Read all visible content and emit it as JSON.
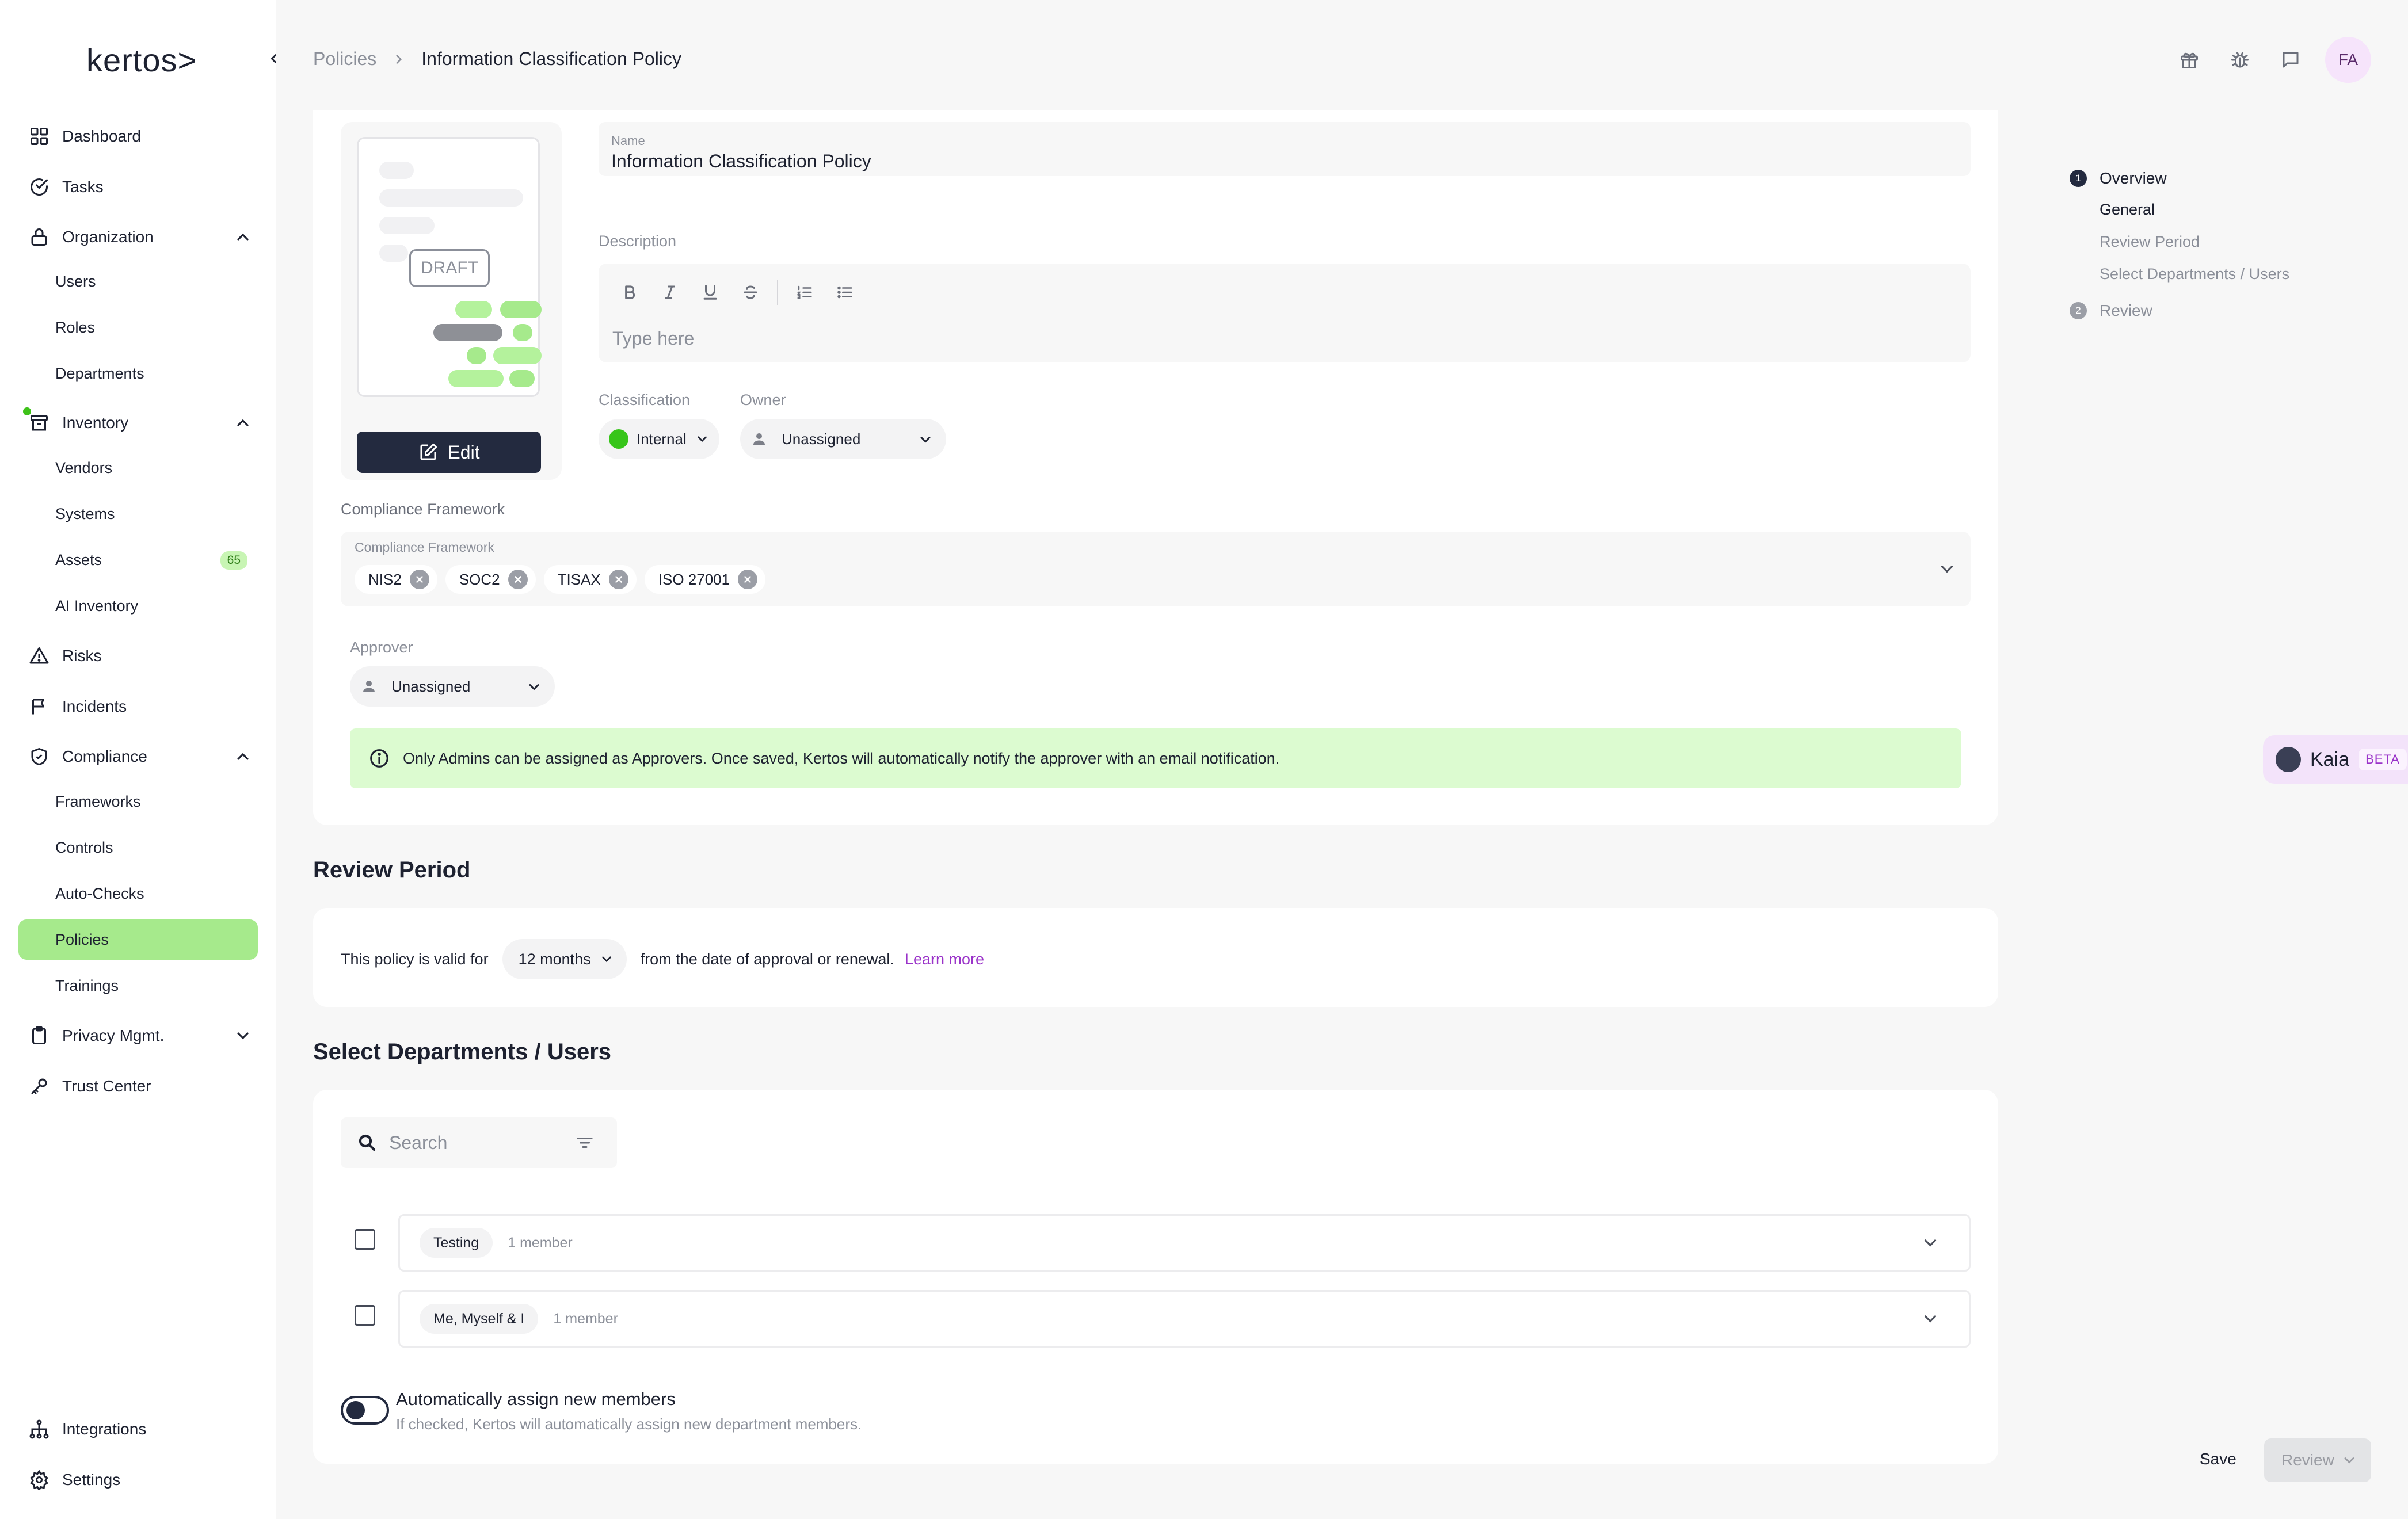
{
  "app": {
    "logo": "kertos>",
    "colors": {
      "accent_green": "#a6ea8c",
      "dark": "#232a3f",
      "purple": "#9a33c9"
    }
  },
  "sidebar": {
    "dashboard": "Dashboard",
    "tasks": "Tasks",
    "organization": "Organization",
    "users": "Users",
    "roles": "Roles",
    "departments": "Departments",
    "inventory": "Inventory",
    "vendors": "Vendors",
    "systems": "Systems",
    "assets": "Assets",
    "assets_count": "65",
    "ai_inventory": "AI Inventory",
    "risks": "Risks",
    "incidents": "Incidents",
    "compliance": "Compliance",
    "frameworks": "Frameworks",
    "controls": "Controls",
    "auto_checks": "Auto-Checks",
    "policies": "Policies",
    "trainings": "Trainings",
    "privacy": "Privacy Mgmt.",
    "trust_center": "Trust Center",
    "integrations": "Integrations",
    "settings": "Settings"
  },
  "header": {
    "breadcrumb_parent": "Policies",
    "breadcrumb_current": "Information Classification Policy",
    "avatar_initials": "FA"
  },
  "overview": {
    "draft_label": "DRAFT",
    "edit_label": "Edit",
    "name_label": "Name",
    "name_value": "Information Classification Policy",
    "description_label": "Description",
    "description_placeholder": "Type here",
    "classification_label": "Classification",
    "classification_value": "Internal",
    "owner_label": "Owner",
    "owner_value": "Unassigned",
    "compliance_section_label": "Compliance Framework",
    "compliance_field_label": "Compliance Framework",
    "frameworks": [
      "NIS2",
      "SOC2",
      "TISAX",
      "ISO 27001"
    ],
    "approver_label": "Approver",
    "approver_value": "Unassigned",
    "info_text": "Only Admins can be assigned as Approvers. Once saved, Kertos will automatically notify the approver with an email notification."
  },
  "review_period": {
    "title": "Review Period",
    "prefix": "This policy is valid for",
    "months": "12 months",
    "suffix": "from the date of approval or renewal.",
    "learn_more": "Learn more"
  },
  "departments": {
    "title": "Select Departments / Users",
    "search_placeholder": "Search",
    "rows": [
      {
        "name": "Testing",
        "members": "1 member"
      },
      {
        "name": "Me, Myself & I",
        "members": "1 member"
      }
    ],
    "toggle_label": "Automatically assign new members",
    "toggle_help": "If checked, Kertos will automatically assign new department members."
  },
  "steps": {
    "step1_num": "1",
    "step1": "Overview",
    "sub1": "General",
    "sub2": "Review Period",
    "sub3": "Select Departments / Users",
    "step2_num": "2",
    "step2": "Review"
  },
  "assistant": {
    "name": "Kaia",
    "badge": "BETA"
  },
  "actions": {
    "save": "Save",
    "review": "Review"
  }
}
